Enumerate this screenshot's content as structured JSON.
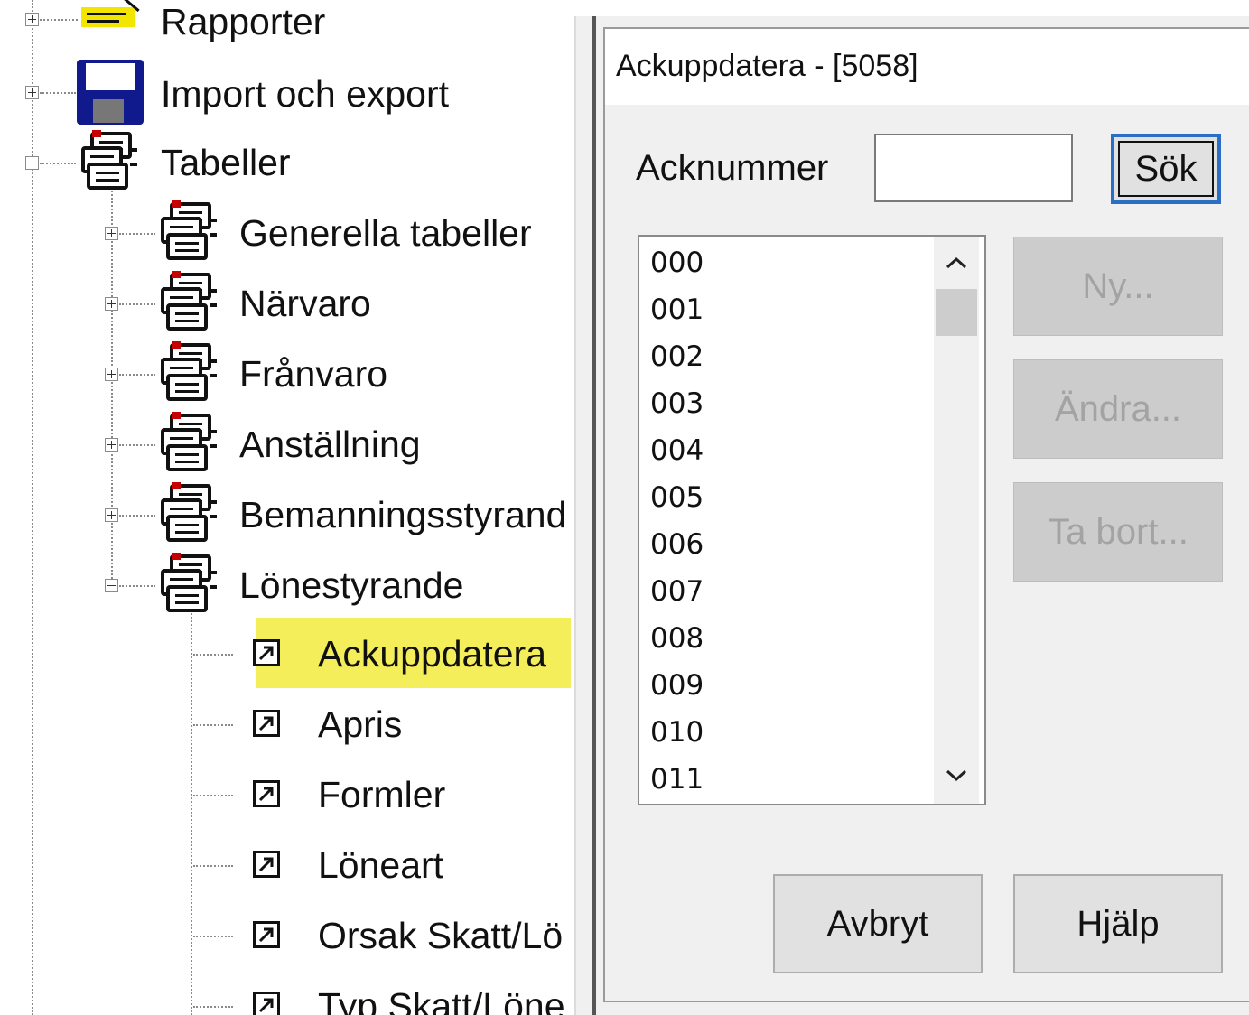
{
  "tree": {
    "items": [
      {
        "label": "Rapporter"
      },
      {
        "label": "Import och export"
      },
      {
        "label": "Tabeller"
      },
      {
        "label": "Generella tabeller"
      },
      {
        "label": "Närvaro"
      },
      {
        "label": "Frånvaro"
      },
      {
        "label": "Anställning"
      },
      {
        "label": "Bemanningsstyrand"
      },
      {
        "label": "Lönestyrande"
      },
      {
        "label": "Ackuppdatera"
      },
      {
        "label": "Apris"
      },
      {
        "label": "Formler"
      },
      {
        "label": "Löneart"
      },
      {
        "label": "Orsak Skatt/Lö"
      },
      {
        "label": "Typ Skatt/Löne"
      }
    ],
    "highlight_color": "#f4ee5a"
  },
  "dialog": {
    "title": "Ackuppdatera - [5058]",
    "acknummer_label": "Acknummer",
    "acknummer_value": "",
    "search_button": "Sök",
    "list_items": [
      "000",
      "001",
      "002",
      "003",
      "004",
      "005",
      "006",
      "007",
      "008",
      "009",
      "010",
      "011"
    ],
    "buttons": {
      "new": "Ny...",
      "edit": "Ändra...",
      "delete": "Ta bort...",
      "cancel": "Avbryt",
      "help": "Hjälp"
    },
    "focus_color": "#2a6fc4"
  }
}
